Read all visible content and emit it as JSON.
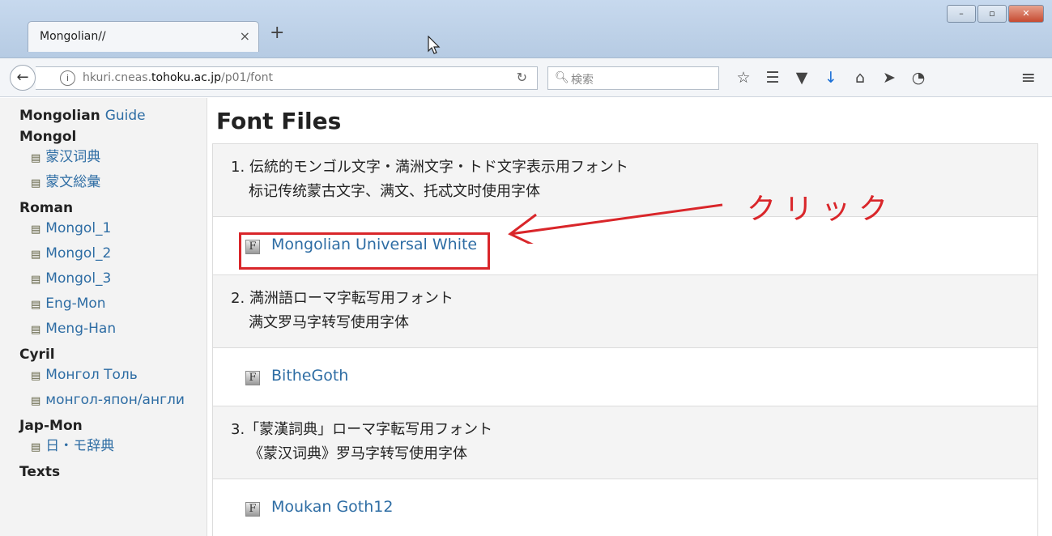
{
  "browser": {
    "tab_title": "Mongolian//",
    "tab_close": "×",
    "new_tab": "+",
    "url_prefix": "hkuri.cneas.",
    "url_domain": "tohoku.ac.jp",
    "url_path": "/p01/font",
    "search_placeholder": "検索",
    "window_buttons": [
      "–",
      "▫",
      "✕"
    ]
  },
  "sidebar": {
    "title_bold": "Mongolian",
    "title_link": "Guide",
    "sections": [
      {
        "heading": "Mongol",
        "items": [
          "蒙汉词典",
          "蒙文総彙"
        ]
      },
      {
        "heading": "Roman",
        "items": [
          "Mongol_1",
          "Mongol_2",
          "Mongol_3",
          "Eng-Mon",
          "Meng-Han"
        ]
      },
      {
        "heading": "Cyril",
        "items": [
          "Монгол Толь",
          "монгол-япон/англи"
        ]
      },
      {
        "heading": "Jap-Mon",
        "items": [
          "日・モ辞典"
        ]
      },
      {
        "heading": "Texts",
        "items": []
      }
    ]
  },
  "main": {
    "title": "Font Files",
    "entries": [
      {
        "line1": "1. 伝統的モンゴル文字・満洲文字・トド文字表示用フォント",
        "line2": "标记传统蒙古文字、满文、托忒文时使用字体",
        "link": "Mongolian Universal White"
      },
      {
        "line1": "2. 満洲語ローマ字転写用フォント",
        "line2": "满文罗马字转写使用字体",
        "link": "BitheGoth"
      },
      {
        "line1": "3.「蒙漢詞典」ローマ字転写用フォント",
        "line2": "《蒙汉词典》罗马字转写使用字体",
        "link": "Moukan Goth12"
      }
    ]
  },
  "annotation": {
    "text": "クリック",
    "color": "#d9262a"
  }
}
